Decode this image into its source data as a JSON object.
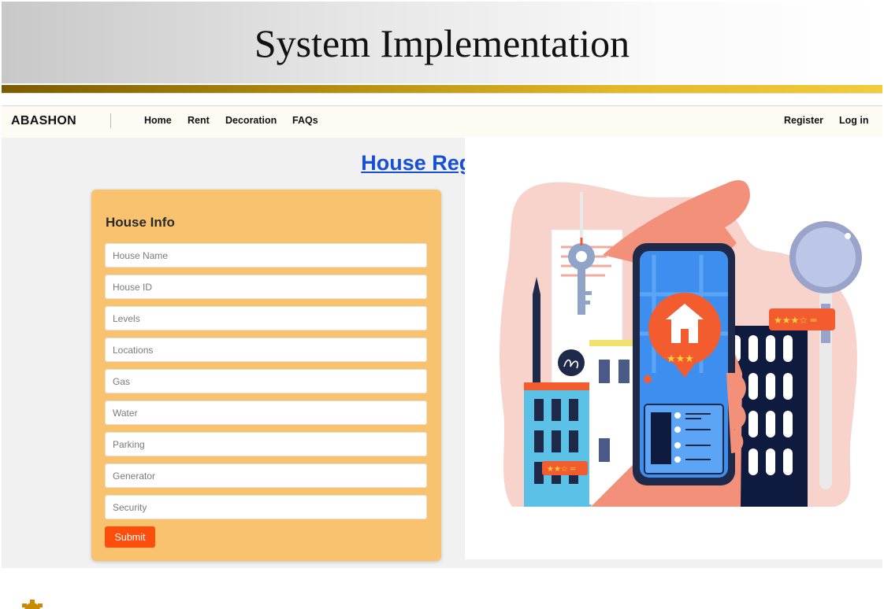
{
  "slide": {
    "title": "System Implementation"
  },
  "navbar": {
    "brand": "ABASHON",
    "links": [
      "Home",
      "Rent",
      "Decoration",
      "FAQs"
    ],
    "auth": {
      "register": "Register",
      "login": "Log in"
    }
  },
  "page": {
    "heading": "House Registration"
  },
  "form": {
    "title": "House Info",
    "fields": [
      {
        "placeholder": "House Name",
        "value": ""
      },
      {
        "placeholder": "House ID",
        "value": ""
      },
      {
        "placeholder": "Levels",
        "value": ""
      },
      {
        "placeholder": "Locations",
        "value": ""
      },
      {
        "placeholder": "Gas",
        "value": ""
      },
      {
        "placeholder": "Water",
        "value": ""
      },
      {
        "placeholder": "Parking",
        "value": ""
      },
      {
        "placeholder": "Generator",
        "value": ""
      },
      {
        "placeholder": "Security",
        "value": ""
      }
    ],
    "submit_label": "Submit"
  },
  "illustration": {
    "icon": "house-search-illustration",
    "pin_rating": "★★★"
  },
  "colors": {
    "brand_link": "#1550d6",
    "card": "#f8c26f",
    "submit": "#ff4d0c",
    "accent_gold": "#e2b826"
  }
}
